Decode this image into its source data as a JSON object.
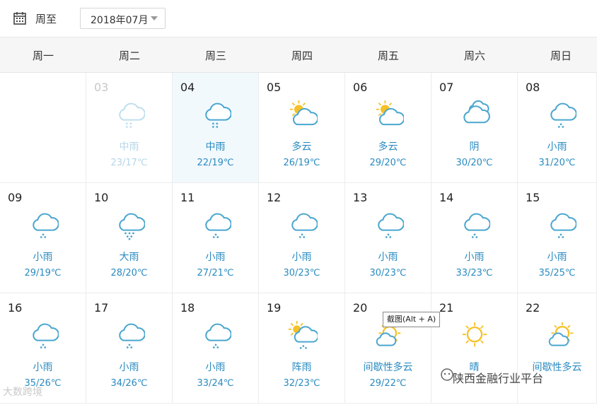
{
  "toolbar": {
    "week_label": "周至",
    "month_value": "2018年07月",
    "icons": [
      "calendar-icon",
      "chevron-down-icon"
    ]
  },
  "weekdays": [
    "周一",
    "周二",
    "周三",
    "周四",
    "周五",
    "周六",
    "周日"
  ],
  "days": [
    {
      "day": "",
      "cond": "",
      "temp": "",
      "icon": "none"
    },
    {
      "day": "03",
      "cond": "中雨",
      "temp": "23/17℃",
      "icon": "rain-medium",
      "state": "past"
    },
    {
      "day": "04",
      "cond": "中雨",
      "temp": "22/19℃",
      "icon": "rain-medium",
      "state": "selected"
    },
    {
      "day": "05",
      "cond": "多云",
      "temp": "26/19℃",
      "icon": "partly-cloudy"
    },
    {
      "day": "06",
      "cond": "多云",
      "temp": "29/20℃",
      "icon": "partly-cloudy"
    },
    {
      "day": "07",
      "cond": "阴",
      "temp": "30/20℃",
      "icon": "overcast"
    },
    {
      "day": "08",
      "cond": "小雨",
      "temp": "31/20℃",
      "icon": "rain-light"
    },
    {
      "day": "09",
      "cond": "小雨",
      "temp": "29/19℃",
      "icon": "rain-light"
    },
    {
      "day": "10",
      "cond": "大雨",
      "temp": "28/20℃",
      "icon": "rain-heavy"
    },
    {
      "day": "11",
      "cond": "小雨",
      "temp": "27/21℃",
      "icon": "rain-light"
    },
    {
      "day": "12",
      "cond": "小雨",
      "temp": "30/23℃",
      "icon": "rain-light"
    },
    {
      "day": "13",
      "cond": "小雨",
      "temp": "30/23℃",
      "icon": "rain-light"
    },
    {
      "day": "14",
      "cond": "小雨",
      "temp": "33/23℃",
      "icon": "rain-light"
    },
    {
      "day": "15",
      "cond": "小雨",
      "temp": "35/25℃",
      "icon": "rain-light"
    },
    {
      "day": "16",
      "cond": "小雨",
      "temp": "35/26℃",
      "icon": "rain-light"
    },
    {
      "day": "17",
      "cond": "小雨",
      "temp": "34/26℃",
      "icon": "rain-light"
    },
    {
      "day": "18",
      "cond": "小雨",
      "temp": "33/24℃",
      "icon": "rain-light"
    },
    {
      "day": "19",
      "cond": "阵雨",
      "temp": "32/23℃",
      "icon": "showers"
    },
    {
      "day": "20",
      "cond": "间歇性多云",
      "temp": "29/22℃",
      "icon": "intermittent-cloudy"
    },
    {
      "day": "21",
      "cond": "晴",
      "temp": "",
      "icon": "sunny"
    },
    {
      "day": "22",
      "cond": "间歇性多云",
      "temp": "",
      "icon": "intermittent-cloudy"
    }
  ],
  "tooltip": "截图(Alt + A)",
  "watermark": {
    "left": "大数跨境",
    "right": "陕西金融行业平台"
  },
  "colors": {
    "sun": "#f6c124",
    "cloud": "#4aa6cf",
    "text_accent": "#2a8bc0",
    "selected_bg": "#f2f9fd"
  }
}
